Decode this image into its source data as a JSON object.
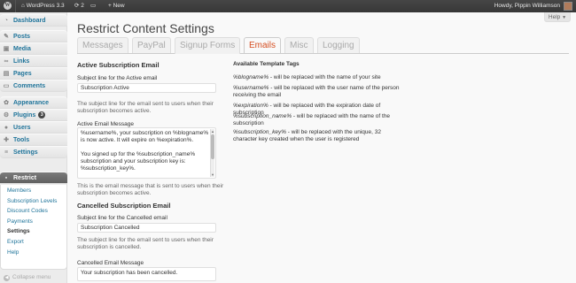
{
  "adminbar": {
    "site_name": "WordPress 3.3",
    "updates_count": "2",
    "comments_count": "",
    "new_label": "New",
    "howdy": "Howdy, Pippin Williamson"
  },
  "menu": {
    "dashboard": "Dashboard",
    "posts": "Posts",
    "media": "Media",
    "links": "Links",
    "pages": "Pages",
    "comments": "Comments",
    "appearance": "Appearance",
    "plugins": "Plugins",
    "plugins_badge": "3",
    "users": "Users",
    "tools": "Tools",
    "settings": "Settings",
    "restrict": "Restrict",
    "submenu": [
      "Members",
      "Subscription Levels",
      "Discount Codes",
      "Payments",
      "Settings",
      "Export",
      "Help"
    ],
    "collapse": "Collapse menu"
  },
  "help_label": "Help",
  "page_title": "Restrict Content Settings",
  "tabs": [
    "Messages",
    "PayPal",
    "Signup Forms",
    "Emails",
    "Misc",
    "Logging"
  ],
  "active_section": {
    "title": "Active Subscription Email",
    "subject_label": "Subject line for the Active email",
    "subject_value": "Subscription Active",
    "subject_desc": "The subject line for the email sent to users when their subscription becomes active.",
    "message_label": "Active Email Message",
    "message_value": "%username%, your subscription on %blogname% is now active. It will expire on %expiration%.\n\nYou signed up for the %subscription_name% subscription and your subscription key is: %subscription_key%.",
    "message_desc": "This is the email message that is sent to users when their subscription becomes active."
  },
  "cancelled_section": {
    "title": "Cancelled Subscription Email",
    "subject_label": "Subject line for the Cancelled email",
    "subject_value": "Subscription Cancelled",
    "subject_desc": "The subject line for the email sent to users when their subscription is cancelled.",
    "message_label": "Cancelled Email Message",
    "message_value": "Your subscription has been cancelled."
  },
  "template_tags": {
    "title": "Available Template Tags",
    "items": [
      {
        "code": "%blogname%",
        "text": " - will be replaced with the name of your site"
      },
      {
        "code": "%username%",
        "text": " - will be replaced with the user name of the person receiving the email"
      },
      {
        "code": "%expiration%",
        "text": " - will be replaced with the expiration date of subscription"
      },
      {
        "code": "%subscription_name%",
        "text": " - will be replaced with the name of the subscription"
      },
      {
        "code": "%subscription_key%",
        "text": " - will be replaced with the unique, 32 character key created when the user is registered"
      }
    ]
  }
}
